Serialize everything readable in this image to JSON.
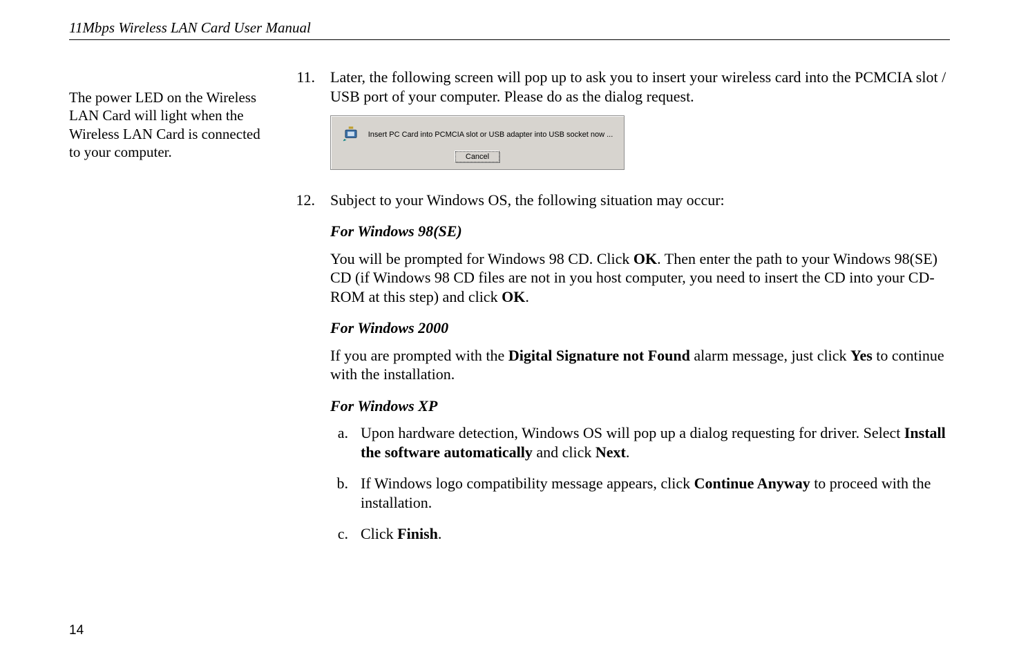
{
  "header": {
    "running_title": "11Mbps Wireless LAN Card User Manual"
  },
  "side_note": "The power LED on the Wireless LAN Card will light when the Wireless LAN Card is connected to your computer.",
  "steps": {
    "s11": {
      "num": "11.",
      "text_a": "Later, the following screen will pop up to ask you to insert your wireless card into the PCMCIA slot / USB port of your computer. Please do as the dialog request."
    },
    "dialog": {
      "message": "Insert PC Card into PCMCIA slot or USB adapter into USB socket now ...",
      "button": "Cancel"
    },
    "s12": {
      "num": "12.",
      "intro": "Subject to your Windows OS, the following situation may occur:",
      "w98_head": "For Windows 98(SE)",
      "w98_p1_a": "You will be prompted for Windows 98 CD. Click ",
      "w98_p1_ok1": "OK",
      "w98_p1_b": ". Then enter the path to your Windows 98(SE) CD (if Windows 98 CD files are not in you host computer, you need to insert the CD into your CD-ROM at this step) and click ",
      "w98_p1_ok2": "OK",
      "w98_p1_c": ".",
      "w2k_head": "For Windows 2000",
      "w2k_a": "If you are prompted with the ",
      "w2k_b": "Digital Signature not Found",
      "w2k_c": " alarm message, just click ",
      "w2k_d": "Yes",
      "w2k_e": " to continue with the installation.",
      "wxp_head": "For Windows XP",
      "xp": {
        "a": {
          "letter": "a.",
          "t1": "Upon hardware detection, Windows OS will pop up a dialog requesting for driver. Select ",
          "t2": "Install the software automatically",
          "t3": " and click ",
          "t4": "Next",
          "t5": "."
        },
        "b": {
          "letter": "b.",
          "t1": "If Windows logo compatibility message appears, click ",
          "t2": "Continue Anyway",
          "t3": " to proceed with the installation."
        },
        "c": {
          "letter": "c.",
          "t1": "Click ",
          "t2": "Finish",
          "t3": "."
        }
      }
    }
  },
  "page_number": "14"
}
